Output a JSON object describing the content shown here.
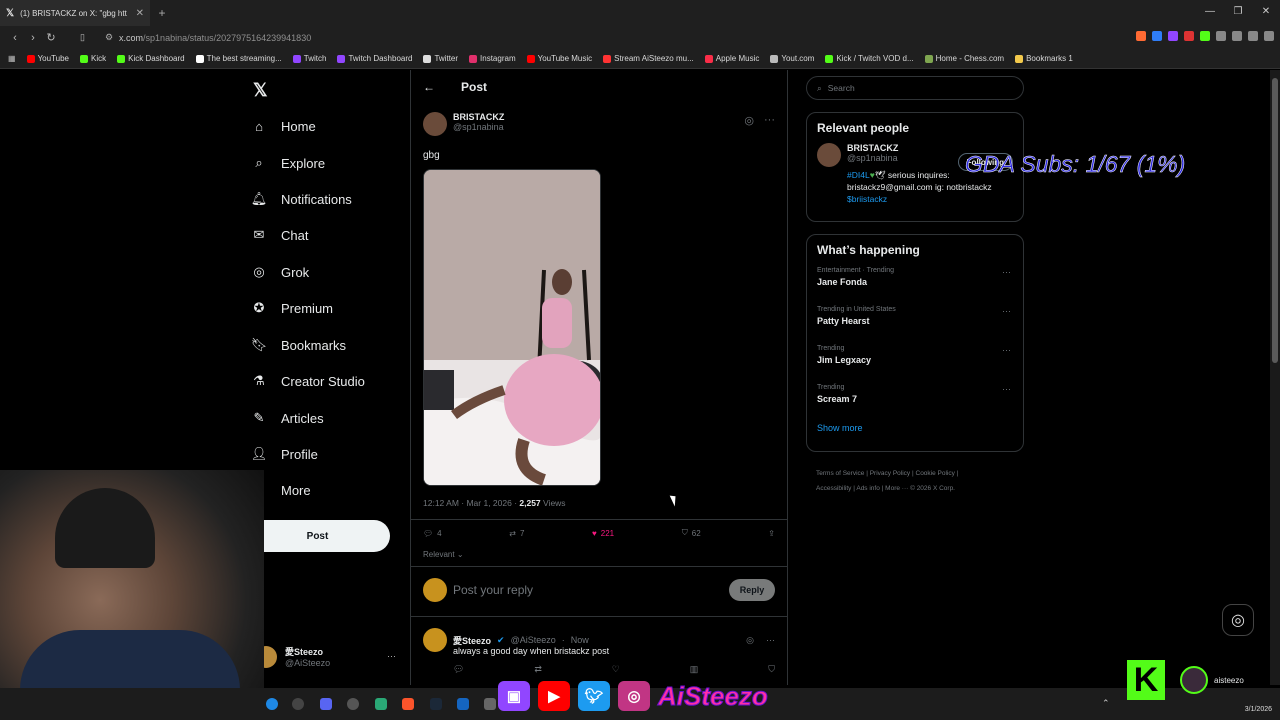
{
  "browser": {
    "tab_title": "(1) BRISTACKZ on X: \"gbg htt",
    "url_host": "x.com",
    "url_path": "/sp1nabina/status/2027975164239941830",
    "bookmarks": [
      {
        "label": "YouTube",
        "color": "#ff0000"
      },
      {
        "label": "Kick",
        "color": "#53fc18"
      },
      {
        "label": "Kick Dashboard",
        "color": "#53fc18"
      },
      {
        "label": "The best streaming...",
        "color": "#ffffff"
      },
      {
        "label": "Twitch",
        "color": "#9146ff"
      },
      {
        "label": "Twitch Dashboard",
        "color": "#9146ff"
      },
      {
        "label": "Twitter",
        "color": "#dddddd"
      },
      {
        "label": "Instagram",
        "color": "#e1306c"
      },
      {
        "label": "YouTube Music",
        "color": "#ff0000"
      },
      {
        "label": "Stream AiSteezo mu...",
        "color": "#ff3333"
      },
      {
        "label": "Apple Music",
        "color": "#fa2d48"
      },
      {
        "label": "Yout.com",
        "color": "#bbbbbb"
      },
      {
        "label": "Kick / Twitch VOD d...",
        "color": "#53fc18"
      },
      {
        "label": "Home - Chess.com",
        "color": "#7fa650"
      },
      {
        "label": "Bookmarks 1",
        "color": "#f2c94c"
      }
    ]
  },
  "nav": {
    "items": [
      {
        "label": "Home",
        "icon": "home-icon"
      },
      {
        "label": "Explore",
        "icon": "search-icon"
      },
      {
        "label": "Notifications",
        "icon": "bell-icon"
      },
      {
        "label": "Chat",
        "icon": "mail-icon"
      },
      {
        "label": "Grok",
        "icon": "grok-icon"
      },
      {
        "label": "Premium",
        "icon": "premium-icon"
      },
      {
        "label": "Bookmarks",
        "icon": "bookmark-icon"
      },
      {
        "label": "Creator Studio",
        "icon": "flask-icon"
      },
      {
        "label": "Articles",
        "icon": "article-icon"
      },
      {
        "label": "Profile",
        "icon": "person-icon"
      },
      {
        "label": "More",
        "icon": "more-circle-icon"
      }
    ],
    "post_button": "Post",
    "account_name": "愛Steezo",
    "account_handle": "@AiSteezo"
  },
  "post": {
    "header": "Post",
    "author_name": "BRISTACKZ",
    "author_handle": "@sp1nabina",
    "text": "gbg",
    "time": "12:12 AM · Mar 1, 2026 · ",
    "views_count": "2,257",
    "views_label": " Views",
    "replies": "4",
    "reposts": "7",
    "likes": "221",
    "bookmarks": "62",
    "sort_label": "Relevant",
    "reply_placeholder": "Post your reply",
    "reply_button": "Reply"
  },
  "reply": {
    "name": "愛Steezo",
    "handle": "@AiSteezo",
    "time": "Now",
    "text": "always a good day when bristackz post"
  },
  "sidebar": {
    "search_placeholder": "Search",
    "relevant_title": "Relevant people",
    "person_name": "BRISTACKZ",
    "person_handle": "@sp1nabina",
    "follow_label": "Following",
    "bio_tag": "#DI4L",
    "bio_text": " serious inquires: bristackz9@gmail.com ig: notbristackz",
    "bio_cashtag": "$briistackz",
    "happening_title": "What’s happening",
    "trends": [
      {
        "category": "Entertainment · Trending",
        "name": "Jane Fonda"
      },
      {
        "category": "Trending in United States",
        "name": "Patty Hearst"
      },
      {
        "category": "Trending",
        "name": "Jim Legxacy"
      },
      {
        "category": "Trending",
        "name": "Scream 7"
      }
    ],
    "show_more": "Show more",
    "footer": [
      "Terms of Service",
      "Privacy Policy",
      "Cookie Policy",
      "Accessibility",
      "Ads info",
      "More ···",
      "© 2026 X Corp."
    ]
  },
  "overlay": {
    "subs": "GDA Subs: 1/67 (1%)",
    "brand": "AiSteezo",
    "kick_user": "aisteezo"
  },
  "taskbar": {
    "date": "3/1/2026"
  }
}
